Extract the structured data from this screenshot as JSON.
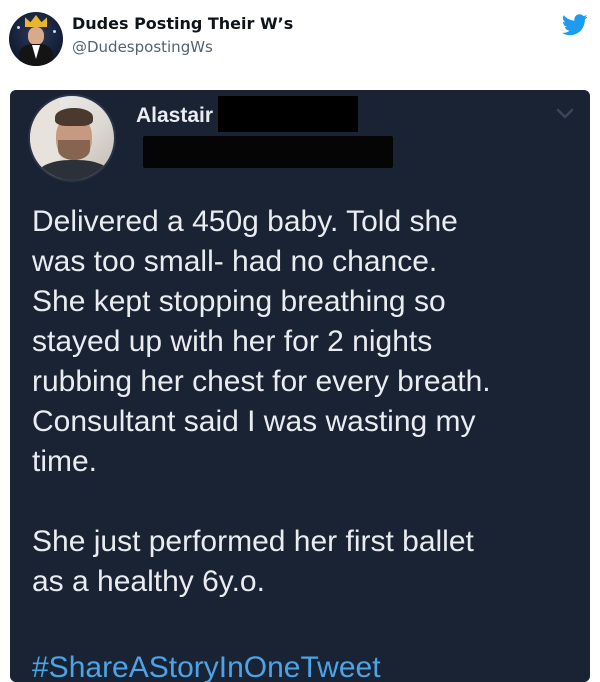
{
  "header": {
    "account_name": "Dudes Posting Their W’s",
    "account_handle": "@DudespostingWs",
    "avatar_icon": "crowned-man-avatar",
    "brand_icon": "twitter-bird-icon",
    "brand_color": "#1d9bf0"
  },
  "embedded_post": {
    "author_name": "Alastair",
    "text": "Delivered a 450g baby. Told she\nwas too small- had no chance.\nShe kept stopping breathing so\nstayed up with her for 2 nights\nrubbing her chest for every breath.\nConsultant said I was wasting my\ntime.\n\nShe just performed her first ballet\nas a healthy 6y.o.",
    "hashtag": "#ShareAStoryInOneTweet",
    "hashtag_color": "#4aa4e8",
    "background_color": "#1a2333",
    "menu_icon": "chevron-down-icon"
  }
}
